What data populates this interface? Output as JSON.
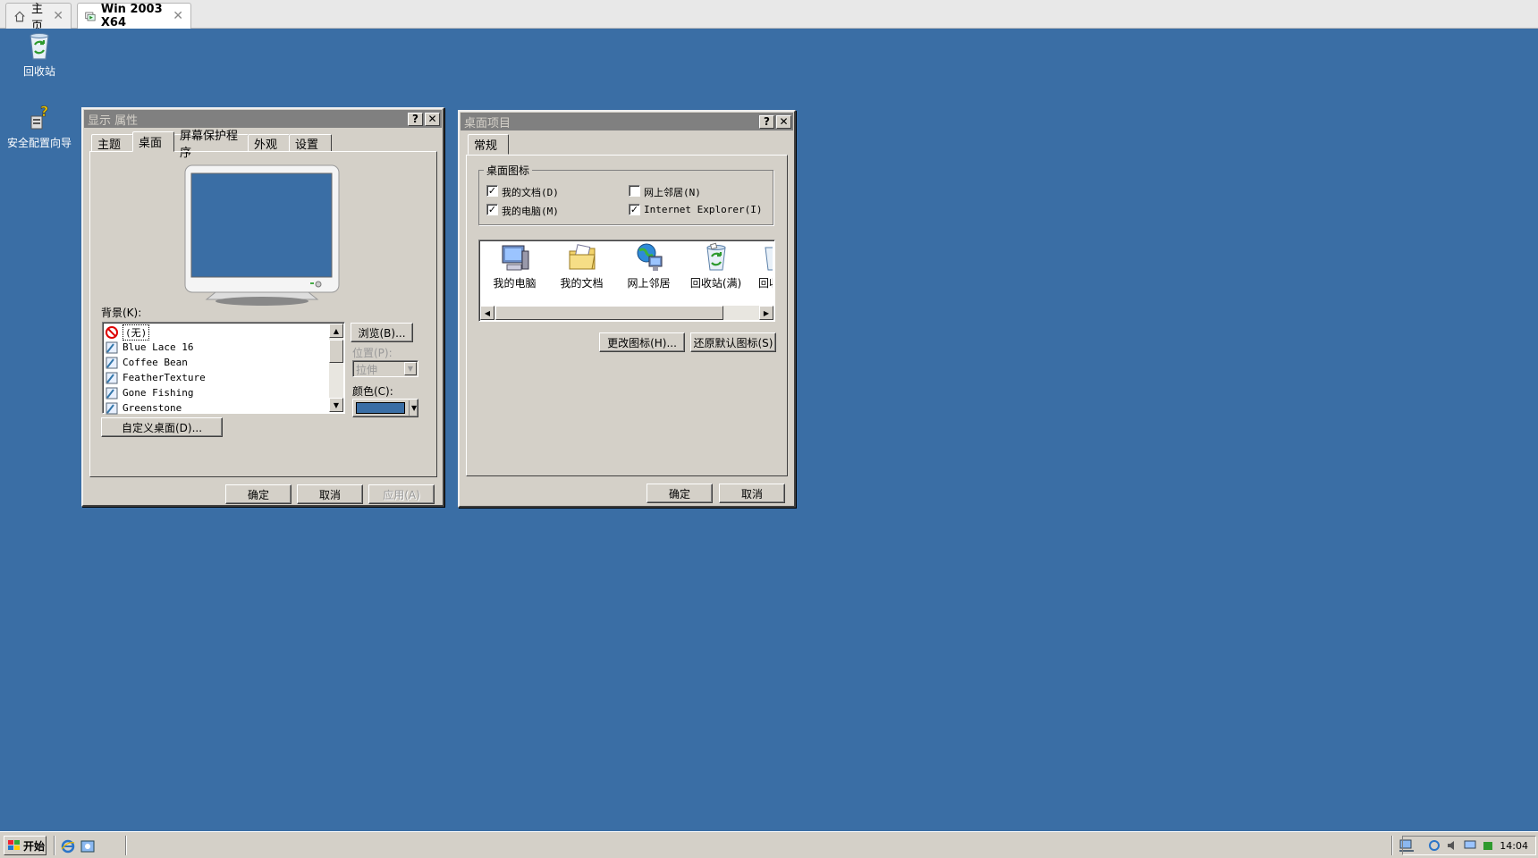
{
  "host": {
    "tabs": [
      {
        "label": "主页",
        "icon": "home-icon"
      },
      {
        "label": "Win 2003 X64",
        "icon": "vm-icon"
      }
    ],
    "close_glyph": "✕"
  },
  "desktop": {
    "icons": [
      {
        "label": "回收站",
        "icon": "recycle-bin-icon"
      },
      {
        "label": "安全配置向导",
        "icon": "security-wizard-icon"
      }
    ]
  },
  "display_props": {
    "title": "显示 属性",
    "help": "?",
    "close": "✕",
    "tabs": [
      "主题",
      "桌面",
      "屏幕保护程序",
      "外观",
      "设置"
    ],
    "background_label": "背景(K):",
    "backgrounds": [
      "(无)",
      "Blue Lace 16",
      "Coffee Bean",
      "FeatherTexture",
      "Gone Fishing",
      "Greenstone"
    ],
    "browse": "浏览(B)...",
    "position_label": "位置(P):",
    "position_value": "拉伸",
    "color_label": "颜色(C):",
    "color_value": "#3a6ea5",
    "customize": "自定义桌面(D)...",
    "ok": "确定",
    "cancel": "取消",
    "apply": "应用(A)"
  },
  "desktop_items": {
    "title": "桌面项目",
    "help": "?",
    "close": "✕",
    "tab": "常规",
    "group_label": "桌面图标",
    "checks": [
      {
        "label": "我的文档(D)",
        "checked": true
      },
      {
        "label": "网上邻居(N)",
        "checked": false
      },
      {
        "label": "我的电脑(M)",
        "checked": true
      },
      {
        "label": "Internet Explorer(I)",
        "checked": true
      }
    ],
    "icons": [
      "我的电脑",
      "我的文档",
      "网上邻居",
      "回收站(满)",
      "回收"
    ],
    "change_icon": "更改图标(H)...",
    "restore_default": "还原默认图标(S)",
    "ok": "确定",
    "cancel": "取消"
  },
  "taskbar": {
    "start": "开始",
    "clock": "14:04"
  },
  "colors": {
    "desktop": "#3a6ea5",
    "face": "#d4d0c8",
    "titlebar_inactive": "#808080"
  }
}
